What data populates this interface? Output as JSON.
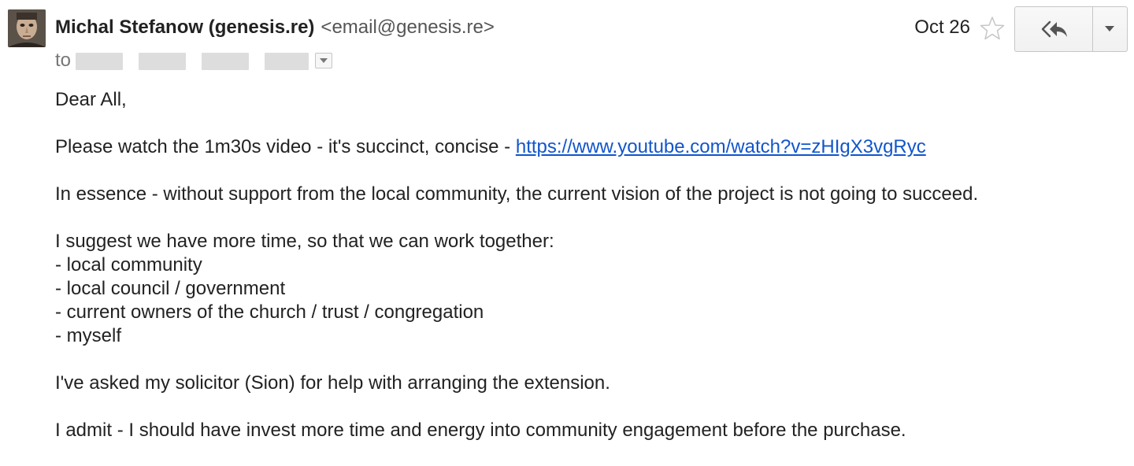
{
  "sender": {
    "name": "Michal Stefanow (genesis.re)",
    "email": "<email@genesis.re>",
    "avatar_icon": "person-photo"
  },
  "recipients": {
    "to_label": "to",
    "redacted": true
  },
  "date": "Oct 26",
  "actions": {
    "star_icon": "star-outline-icon",
    "reply_icon": "reply-all-icon",
    "more_icon": "chevron-down-icon"
  },
  "message": {
    "greeting": "Dear All,",
    "para1_text": "Please watch the 1m30s video - it's succinct, concise - ",
    "para1_link": "https://www.youtube.com/watch?v=zHIgX3vgRyc",
    "para2": "In essence - without support from the local community, the current vision of the project is not going to succeed.",
    "para3_intro": "I suggest we have more time, so that we can work together:",
    "list": [
      "- local community",
      "- local council / government",
      "- current owners of the church / trust / congregation",
      "- myself"
    ],
    "para4": "I've asked my solicitor (Sion) for help with arranging the extension.",
    "para5": "I admit - I should have invest more time and energy into community engagement before the purchase."
  },
  "colors": {
    "link": "#1155cc",
    "text": "#222222",
    "muted": "#777777",
    "button_border": "#c6c6c6"
  }
}
